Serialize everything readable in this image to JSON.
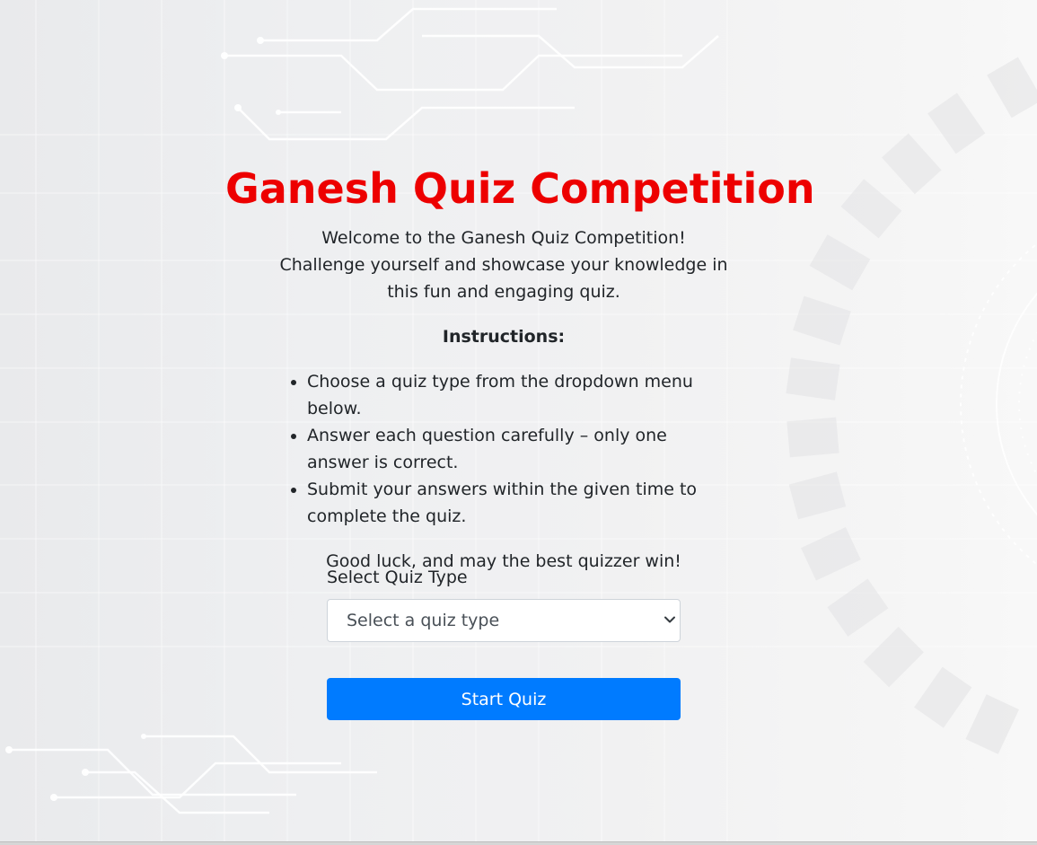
{
  "page": {
    "title": "Ganesh Quiz Competition",
    "intro": "Welcome to the Ganesh Quiz Competition! Challenge yourself and showcase your knowledge in this fun and engaging quiz.",
    "instructions_heading": "Instructions:",
    "instructions": [
      "Choose a quiz type from the dropdown menu below.",
      "Answer each question carefully – only one answer is correct.",
      "Submit your answers within the given time to complete the quiz."
    ],
    "closing": "Good luck, and may the best quizzer win!"
  },
  "form": {
    "select_label": "Select Quiz Type",
    "select_value": "Select a quiz type",
    "start_button": "Start Quiz"
  },
  "colors": {
    "title": "#ed0000",
    "button": "#007bff",
    "text": "#212529"
  },
  "icons": {
    "select_chevron": "chevron-down-icon"
  }
}
